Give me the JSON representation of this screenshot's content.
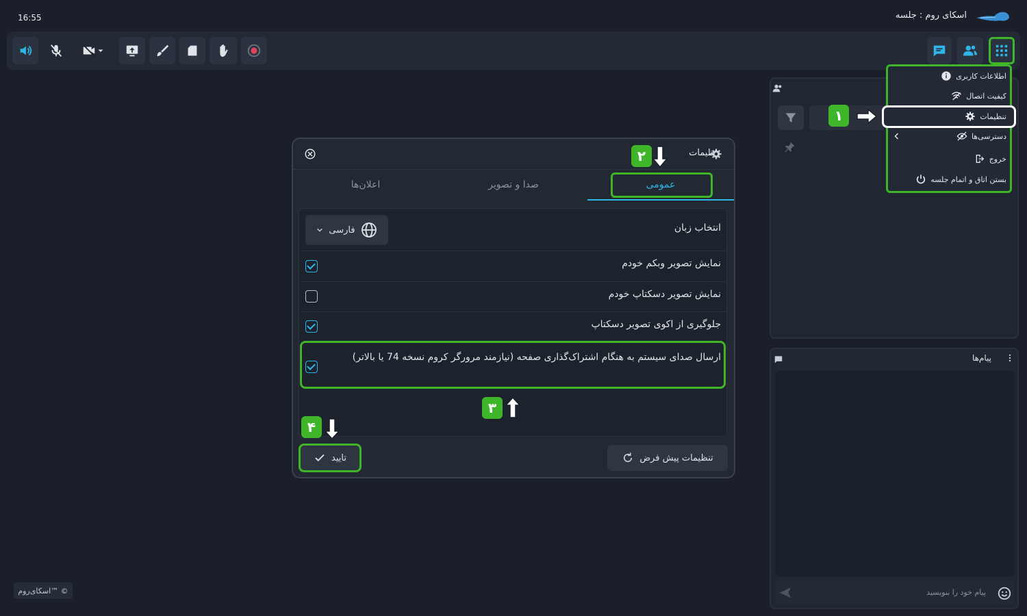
{
  "header": {
    "clock": "16:55",
    "app_title": "اسکای روم : جلسه"
  },
  "toolbar": {
    "icons": [
      "speaker-icon",
      "mic-off-icon",
      "camera-off-icon",
      "share-screen-icon",
      "whiteboard-icon",
      "files-icon",
      "raise-hand-icon",
      "record-icon",
      "chat-icon",
      "users-icon",
      "apps-grid-icon"
    ]
  },
  "menu": {
    "items": [
      {
        "label": "اطلاعات کاربری",
        "icon": "info-icon"
      },
      {
        "label": "کیفیت اتصال",
        "icon": "wifi-icon"
      },
      {
        "label": "تنظیمات",
        "icon": "gear-icon"
      },
      {
        "label": "دسترسی‌ها",
        "icon": "eye-off-icon"
      },
      {
        "label": "خروج",
        "icon": "logout-icon"
      },
      {
        "label": "بستن اتاق و اتمام جلسه",
        "icon": "power-icon"
      }
    ]
  },
  "messages": {
    "title": "پیام‌ها",
    "placeholder": "پیام خود را بنویسید"
  },
  "settings": {
    "title": "تنظیمات",
    "tabs": [
      "عمومی",
      "صدا و تصویر",
      "اعلان‌ها"
    ],
    "language_label": "انتخاب زبان",
    "language_value": "فارسی",
    "options": [
      {
        "label": "نمایش تصویر وبکم خودم",
        "checked": true
      },
      {
        "label": "نمایش تصویر دسکتاپ خودم",
        "checked": false
      },
      {
        "label": "جلوگیری از اکوی تصویر دسکتاپ",
        "checked": true
      },
      {
        "label": "ارسال صدای سیستم به هنگام اشتراک‌گذاری صفحه (نیازمند مرورگر کروم نسخه 74 یا بالاتر)",
        "checked": true
      }
    ],
    "default_button": "تنظیمات پیش فرض",
    "confirm_button": "تایید"
  },
  "badges": [
    "۱",
    "۲",
    "۳",
    "۴"
  ],
  "footer": {
    "copyright": "اسکای‌روم™ ©"
  },
  "colors": {
    "accent": "#2fb5e8",
    "highlight": "#3fb62a",
    "background": "#1a1f29"
  }
}
